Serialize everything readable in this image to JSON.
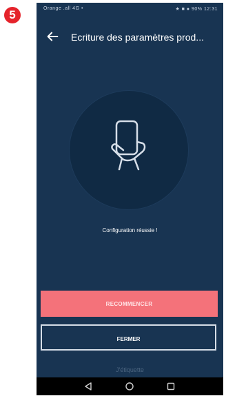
{
  "step_badge": "5",
  "status_bar": {
    "left": "Orange  .all  4G  •",
    "right": "★ ■ ● 90% 12:31"
  },
  "app_bar": {
    "title": "Ecriture des paramètres prod..."
  },
  "main": {
    "status_message": "Configuration réussie !"
  },
  "buttons": {
    "restart_label": "RECOMMENCER",
    "close_label": "FERMER"
  },
  "link_text": "J'étiquette",
  "icons": {
    "back": "arrow-left-icon",
    "hero": "phone-in-hand-icon",
    "nav_back": "triangle-back-icon",
    "nav_home": "circle-home-icon",
    "nav_recents": "square-recents-icon"
  },
  "colors": {
    "background": "#183452",
    "hero_circle": "#102a44",
    "primary_button": "#f4727a",
    "badge": "#e5232b"
  }
}
